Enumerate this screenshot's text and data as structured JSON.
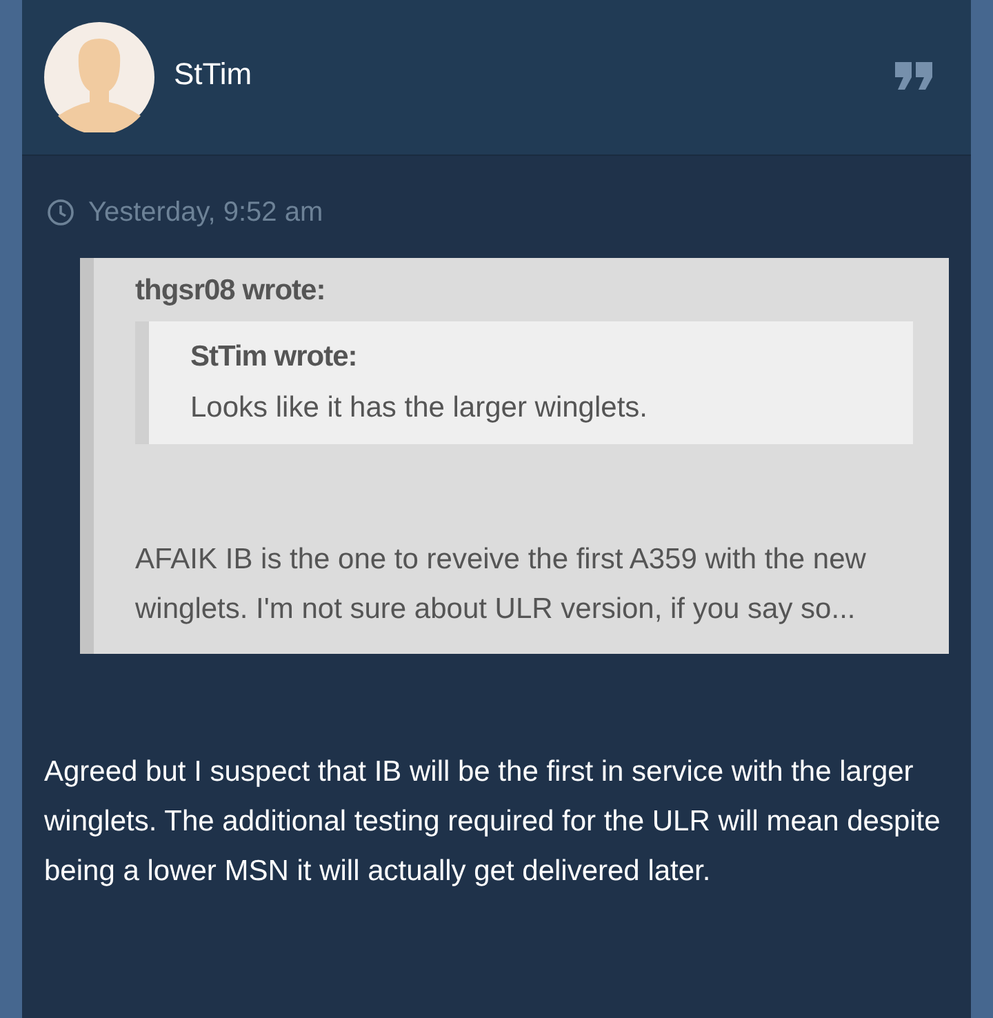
{
  "post": {
    "author": "StTim",
    "time": "Yesterday, 9:52 am",
    "quote": {
      "author_line": "thgsr08 wrote:",
      "nested_quote": {
        "author_line": "StTim wrote:",
        "text": "Looks like it has the larger winglets."
      },
      "text": "AFAIK IB is the one to reveive the first A359 with the new winglets. I'm not sure about ULR version, if you say so..."
    },
    "body": "Agreed but I suspect that IB will be the first in service with the larger winglets. The additional testing required for the ULR will mean despite being a lower MSN it will actually get delivered later."
  }
}
